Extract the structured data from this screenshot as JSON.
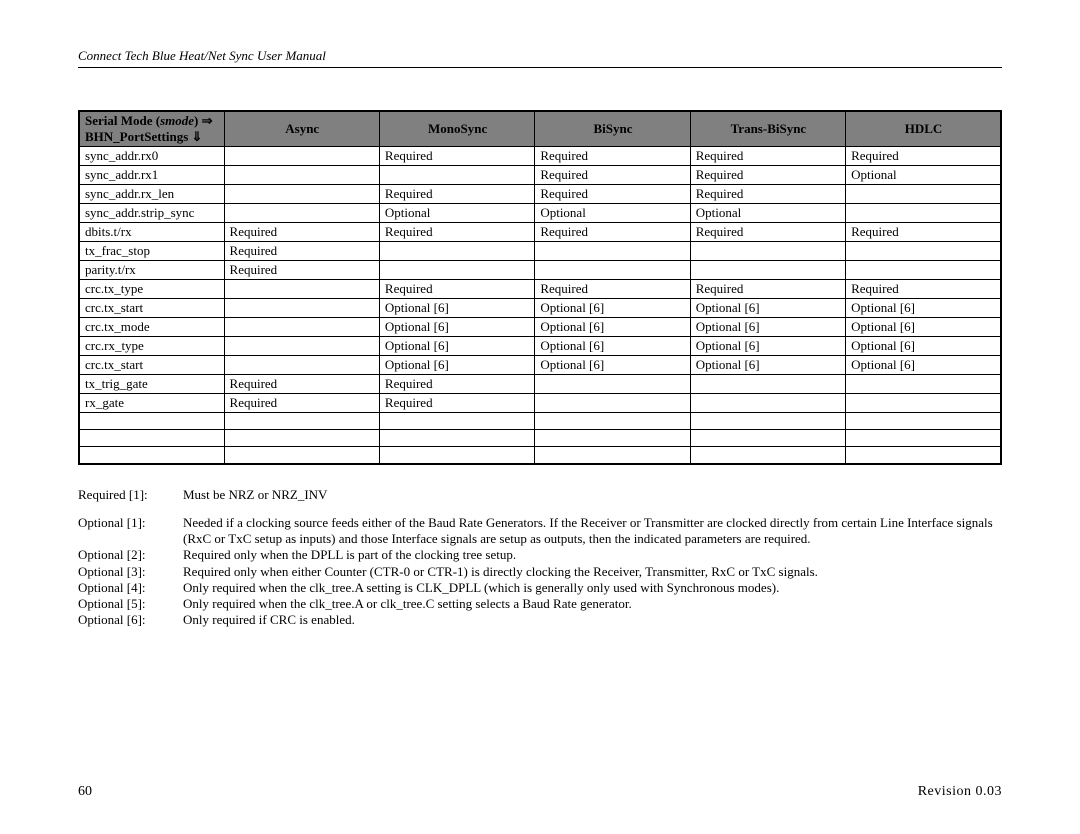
{
  "header": "Connect Tech Blue Heat/Net Sync User Manual",
  "colgroup": [
    "col0",
    "col1",
    "col2",
    "col3",
    "col4",
    "col5"
  ],
  "th": {
    "c0a": "Serial Mode (",
    "c0b": "smode",
    "c0c": ") ",
    "c0arrow": "⇒",
    "c0line2a": "BHN_PortSettings ",
    "c0line2arrow": "⇓",
    "c1": "Async",
    "c2": "MonoSync",
    "c3": "BiSync",
    "c4": "Trans-BiSync",
    "c5": "HDLC"
  },
  "rows": [
    {
      "n": "sync_addr.rx0",
      "c": [
        "",
        "Required",
        "Required",
        "Required",
        "Required"
      ]
    },
    {
      "n": "sync_addr.rx1",
      "c": [
        "",
        "",
        "Required",
        "Required",
        "Optional"
      ]
    },
    {
      "n": "sync_addr.rx_len",
      "c": [
        "",
        "Required",
        "Required",
        "Required",
        ""
      ]
    },
    {
      "n": "sync_addr.strip_sync",
      "c": [
        "",
        "Optional",
        "Optional",
        "Optional",
        ""
      ]
    },
    {
      "n": "dbits.t/rx",
      "c": [
        "Required",
        "Required",
        "Required",
        "Required",
        "Required"
      ]
    },
    {
      "n": "tx_frac_stop",
      "c": [
        "Required",
        "",
        "",
        "",
        ""
      ]
    },
    {
      "n": "parity.t/rx",
      "c": [
        "Required",
        "",
        "",
        "",
        ""
      ]
    },
    {
      "n": "crc.tx_type",
      "c": [
        "",
        "Required",
        "Required",
        "Required",
        "Required"
      ]
    },
    {
      "n": "crc.tx_start",
      "c": [
        "",
        "Optional [6]",
        "Optional [6]",
        "Optional [6]",
        "Optional [6]"
      ]
    },
    {
      "n": "crc.tx_mode",
      "c": [
        "",
        "Optional [6]",
        "Optional [6]",
        "Optional [6]",
        "Optional [6]"
      ]
    },
    {
      "n": "crc.rx_type",
      "c": [
        "",
        "Optional [6]",
        "Optional [6]",
        "Optional [6]",
        "Optional [6]"
      ]
    },
    {
      "n": "crc.tx_start",
      "c": [
        "",
        "Optional [6]",
        "Optional [6]",
        "Optional [6]",
        "Optional [6]"
      ]
    },
    {
      "n": "tx_trig_gate",
      "c": [
        "Required",
        "Required",
        "",
        "",
        ""
      ]
    },
    {
      "n": "rx_gate",
      "c": [
        "Required",
        "Required",
        "",
        "",
        ""
      ]
    },
    {
      "n": "",
      "c": [
        "",
        "",
        "",
        "",
        ""
      ]
    },
    {
      "n": "",
      "c": [
        "",
        "",
        "",
        "",
        ""
      ]
    },
    {
      "n": "",
      "c": [
        "",
        "",
        "",
        "",
        ""
      ]
    }
  ],
  "notes": [
    {
      "label": "Required [1]:",
      "text": "Must be NRZ or NRZ_INV",
      "gap": true
    },
    {
      "label": "Optional [1]:",
      "text": "Needed if a clocking source feeds either of the Baud Rate Generators. If the Receiver or Transmitter are clocked directly from certain Line Interface signals (RxC or TxC setup as inputs) and those Interface signals are setup as outputs, then the indicated parameters are required."
    },
    {
      "label": "Optional [2]:",
      "text": "Required only when the DPLL is part of the clocking tree setup."
    },
    {
      "label": "Optional [3]:",
      "text": "Required only when either Counter (CTR-0 or CTR-1) is directly clocking the Receiver, Transmitter, RxC or TxC signals."
    },
    {
      "label": "Optional [4]:",
      "text": "Only required when the clk_tree.A setting is CLK_DPLL (which is generally only used with Synchronous modes)."
    },
    {
      "label": "Optional [5]:",
      "text": "Only required when the clk_tree.A or clk_tree.C setting selects a Baud Rate generator."
    },
    {
      "label": "Optional [6]:",
      "text": "Only required if CRC is enabled."
    }
  ],
  "footer": {
    "page": "60",
    "rev": "Revision 0.03"
  }
}
